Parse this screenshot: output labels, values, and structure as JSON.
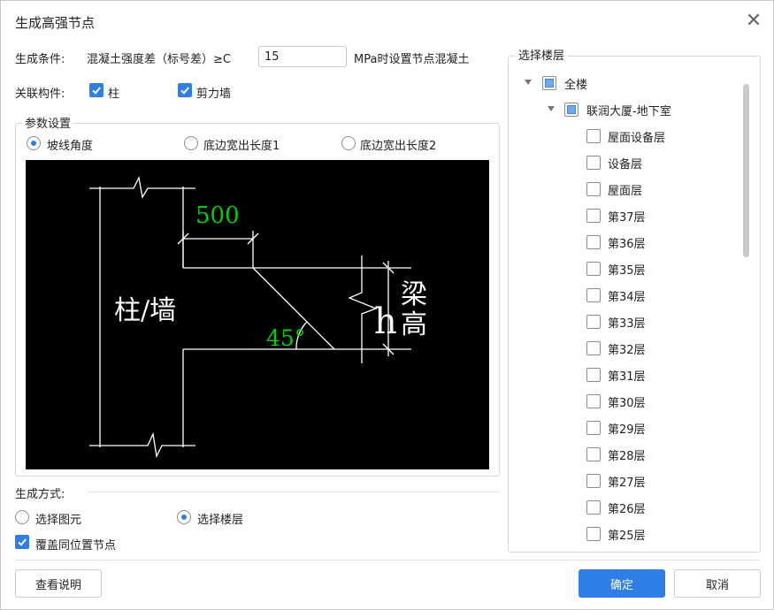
{
  "dialog": {
    "title": "生成高强节点",
    "close_icon": "close-icon"
  },
  "condition": {
    "label": "生成条件:",
    "text_before": "混凝土强度差（标号差）≥C",
    "value": "15",
    "text_after": "MPa时设置节点混凝土"
  },
  "related": {
    "label": "关联构件:",
    "items": [
      {
        "label": "柱",
        "checked": true
      },
      {
        "label": "剪力墙",
        "checked": true
      }
    ]
  },
  "params": {
    "title": "参数设置",
    "options": [
      {
        "label": "坡线角度",
        "selected": true
      },
      {
        "label": "底边宽出长度1",
        "selected": false
      },
      {
        "label": "底边宽出长度2",
        "selected": false
      }
    ]
  },
  "diagram": {
    "dim_500": "500",
    "angle": "45°",
    "column_label": "柱/墙",
    "h_label": "h",
    "beam_label_1": "梁",
    "beam_label_2": "高",
    "background": "#000000",
    "line_color": "#ffffff",
    "accent_color": "#00d000"
  },
  "mode": {
    "label": "生成方式:",
    "options": [
      {
        "label": "选择图元",
        "selected": false
      },
      {
        "label": "选择楼层",
        "selected": true
      }
    ],
    "overwrite": {
      "label": "覆盖同位置节点",
      "checked": true
    }
  },
  "floors": {
    "title": "选择楼层",
    "root": {
      "label": "全楼",
      "state": "partial",
      "expanded": true
    },
    "building": {
      "label": "联润大厦-地下室",
      "state": "partial",
      "expanded": true
    },
    "items": [
      {
        "label": "屋面设备层",
        "checked": false
      },
      {
        "label": "设备层",
        "checked": false
      },
      {
        "label": "屋面层",
        "checked": false
      },
      {
        "label": "第37层",
        "checked": false
      },
      {
        "label": "第36层",
        "checked": false
      },
      {
        "label": "第35层",
        "checked": false
      },
      {
        "label": "第34层",
        "checked": false
      },
      {
        "label": "第33层",
        "checked": false
      },
      {
        "label": "第32层",
        "checked": false
      },
      {
        "label": "第31层",
        "checked": false
      },
      {
        "label": "第30层",
        "checked": false
      },
      {
        "label": "第29层",
        "checked": false
      },
      {
        "label": "第28层",
        "checked": false
      },
      {
        "label": "第27层",
        "checked": false
      },
      {
        "label": "第26层",
        "checked": false
      },
      {
        "label": "第25层",
        "checked": false
      }
    ]
  },
  "buttons": {
    "help": "查看说明",
    "ok": "确定",
    "cancel": "取消"
  },
  "colors": {
    "accent": "#2f7ee6"
  }
}
